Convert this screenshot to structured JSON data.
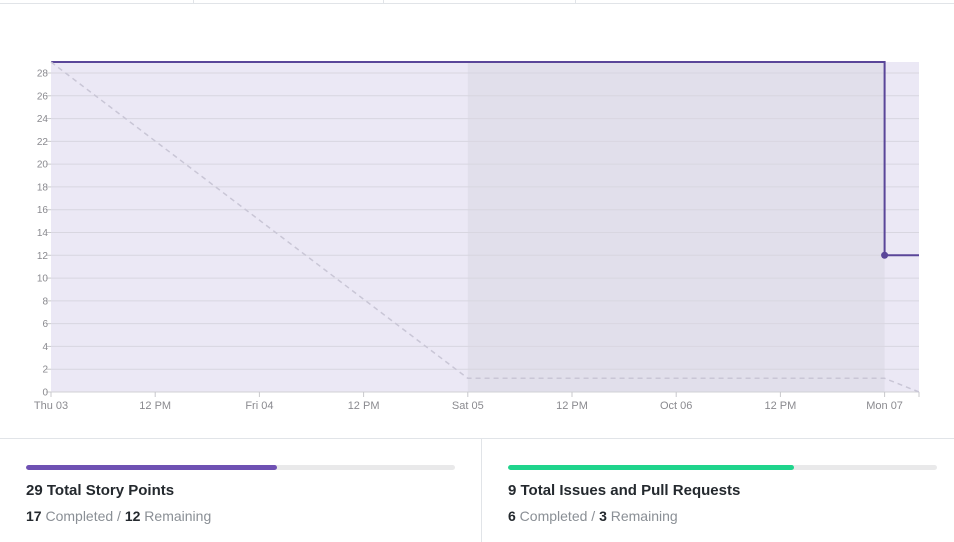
{
  "chart_data": {
    "type": "line",
    "title": "",
    "xlabel": "",
    "ylabel": "",
    "ylim": [
      0,
      28
    ],
    "y_ticks": [
      0,
      2,
      4,
      6,
      8,
      10,
      12,
      14,
      16,
      18,
      20,
      22,
      24,
      26,
      28
    ],
    "x_tick_labels": [
      "Thu 03",
      "12 PM",
      "Fri 04",
      "12 PM",
      "Sat 05",
      "12 PM",
      "Oct 06",
      "12 PM",
      "Mon 07"
    ],
    "x_range_hours": [
      0,
      83
    ],
    "weekend_shade_hours": [
      48,
      96
    ],
    "grid": true,
    "series": [
      {
        "style": "solid",
        "color": "#5a4699",
        "points": [
          [
            0,
            29
          ],
          [
            96,
            29
          ],
          [
            96,
            12
          ],
          [
            100,
            12
          ]
        ],
        "marker_at": [
          96,
          12
        ]
      },
      {
        "style": "dashed",
        "color": "#c9c6d6",
        "points": [
          [
            0,
            29
          ],
          [
            48,
            1.2
          ],
          [
            96,
            1.2
          ],
          [
            100,
            0
          ]
        ]
      }
    ]
  },
  "stats": [
    {
      "title": "29 Total Story Points",
      "completed_count": "17",
      "completed_label": " Completed / ",
      "remaining_count": "12",
      "remaining_label": " Remaining",
      "progress": 0.586,
      "color": "#6f51b3"
    },
    {
      "title": "9 Total Issues and Pull Requests",
      "completed_count": "6",
      "completed_label": " Completed / ",
      "remaining_count": "3",
      "remaining_label": " Remaining",
      "progress": 0.667,
      "color": "#1fd48c"
    }
  ]
}
